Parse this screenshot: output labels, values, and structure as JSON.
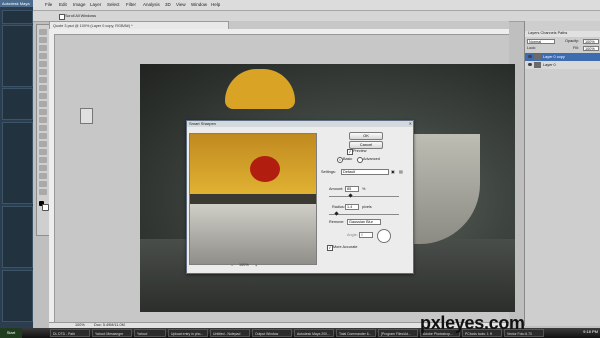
{
  "maya": {
    "title": "Autodesk Maya"
  },
  "menubar": {
    "items": [
      "File",
      "Edit",
      "Image",
      "Layer",
      "Select",
      "Filter",
      "Analysis",
      "3D",
      "View",
      "Window",
      "Help"
    ]
  },
  "optbar": {
    "checkbox_label": "Scroll All Windows"
  },
  "document": {
    "tab_title": "Quote 3.psd @ 100% (Layer 0 copy, RGB/8#) *",
    "status_zoom": "100%",
    "status_doc": "Doc: 5.49M/11.0M"
  },
  "layers": {
    "tabs": [
      "Layers",
      "Channels",
      "Paths"
    ],
    "blend_mode": "Normal",
    "opacity_label": "Opacity:",
    "opacity_value": "100%",
    "lock_label": "Lock:",
    "fill_label": "Fill:",
    "fill_value": "100%",
    "items": [
      {
        "name": "Layer 0 copy"
      },
      {
        "name": "Layer 0"
      }
    ]
  },
  "dialog": {
    "title": "Smart Sharpen",
    "ok": "OK",
    "cancel": "Cancel",
    "preview_label": "Preview",
    "mode_basic": "Basic",
    "mode_advanced": "Advanced",
    "settings_label": "Settings:",
    "settings_value": "Default",
    "amount_label": "Amount:",
    "amount_value": "85",
    "amount_unit": "%",
    "radius_label": "Radius:",
    "radius_value": "1.4",
    "radius_unit": "pixels",
    "remove_label": "Remove:",
    "remove_value": "Gaussian Blur",
    "angle_label": "Angle:",
    "angle_value": "0",
    "more_accurate": "More Accurate",
    "preview_zoom": "100%"
  },
  "taskbar": {
    "start": "Start",
    "tasks": [
      "DL DTD - Path",
      "Yahoo! Messenger",
      "Yahoo!",
      "Upload entry in pho...",
      "Untitled - Notepad",
      "Output Window",
      "Autodesk Maya 200...",
      "Total Commander 6...",
      "[Program Files\\Ad...",
      "Adobe Photoshop...",
      "PCtools tools: 1 H",
      "Vector Foto 6.70"
    ],
    "clock": "9:18 PM"
  },
  "watermark": {
    "text": "pxleyes.com"
  }
}
